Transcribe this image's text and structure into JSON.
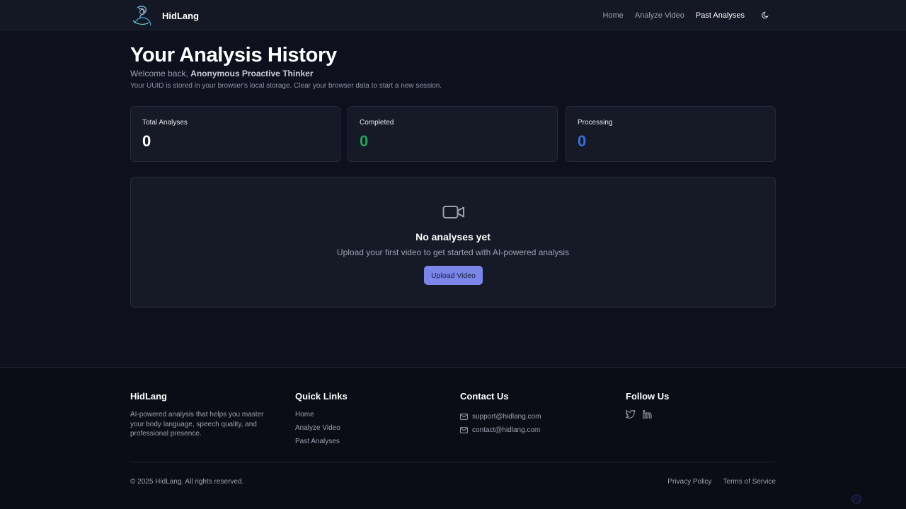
{
  "header": {
    "brand": "HidLang",
    "nav": [
      "Home",
      "Analyze Video",
      "Past Analyses"
    ],
    "active_nav": "Past Analyses",
    "theme_icon": "moon-icon"
  },
  "main": {
    "title": "Your Analysis History",
    "welcome_prefix": "Welcome back,",
    "user_name": "Anonymous Proactive Thinker",
    "uuid_note": "Your UUID is stored in your browser's local storage. Clear your browser data to start a new session.",
    "stats": [
      {
        "label": "Total Analyses",
        "value": "0",
        "color": "#ffffff"
      },
      {
        "label": "Completed",
        "value": "0",
        "color": "#22a35a"
      },
      {
        "label": "Processing",
        "value": "0",
        "color": "#3b6fe0"
      }
    ],
    "empty_state": {
      "icon": "video-camera-icon",
      "title": "No analyses yet",
      "subtitle": "Upload your first video to get started with AI-powered analysis",
      "button": "Upload Video"
    }
  },
  "footer": {
    "brand": "HidLang",
    "description": "AI-powered analysis that helps you master your body language, speech quality, and professional presence.",
    "quick_links_title": "Quick Links",
    "quick_links": [
      "Home",
      "Analyze Video",
      "Past Analyses"
    ],
    "contact_title": "Contact Us",
    "contacts": [
      "support@hidlang.com",
      "contact@hidlang.com"
    ],
    "follow_title": "Follow Us",
    "social_icons": [
      "twitter-icon",
      "linkedin-icon"
    ],
    "copyright": "© 2025 HidLang. All rights reserved.",
    "legal": [
      "Privacy Policy",
      "Terms of Service"
    ]
  },
  "colors": {
    "background": "#0e111d",
    "card": "#161a27",
    "accent_button": "#7b86e8"
  }
}
